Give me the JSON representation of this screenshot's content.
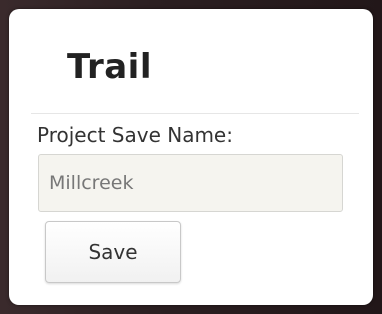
{
  "panel": {
    "title": "Trail",
    "field_label": "Project Save Name:",
    "project_name": {
      "value": "Millcreek",
      "placeholder": ""
    },
    "save_label": "Save"
  },
  "colors": {
    "panel_background": "#ffffff",
    "input_background": "#f5f4ef",
    "title_text": "#222222"
  }
}
